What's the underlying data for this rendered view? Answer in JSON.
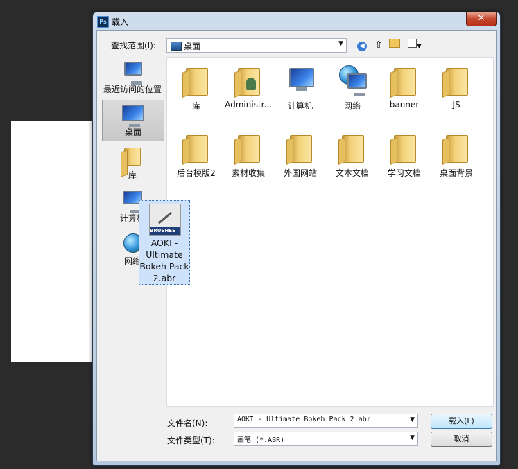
{
  "window": {
    "title": "载入",
    "app_icon": "Ps"
  },
  "toolbar": {
    "lookin_label": "查找范围(I):",
    "lookin_value": "桌面"
  },
  "places": [
    {
      "label": "最近访问的位置",
      "icon": "recent-places-icon"
    },
    {
      "label": "桌面",
      "icon": "desktop-icon"
    },
    {
      "label": "库",
      "icon": "library-icon"
    },
    {
      "label": "计算机",
      "icon": "computer-icon"
    },
    {
      "label": "网络",
      "icon": "network-icon"
    }
  ],
  "files": [
    {
      "label": "库",
      "icon": "library-icon"
    },
    {
      "label": "Administr...",
      "icon": "user-folder-icon"
    },
    {
      "label": "计算机",
      "icon": "computer-icon"
    },
    {
      "label": "网络",
      "icon": "network-icon"
    },
    {
      "label": "banner",
      "icon": "folder-icon"
    },
    {
      "label": "JS",
      "icon": "folder-icon"
    },
    {
      "label": "后台模版2",
      "icon": "folder-icon"
    },
    {
      "label": "素材收集",
      "icon": "folder-icon"
    },
    {
      "label": "外国网站",
      "icon": "folder-icon"
    },
    {
      "label": "文本文档",
      "icon": "folder-icon"
    },
    {
      "label": "学习文档",
      "icon": "folder-icon"
    },
    {
      "label": "桌面背景",
      "icon": "folder-icon"
    }
  ],
  "selected_file": {
    "lines": [
      "AOKI -",
      "Ultimate",
      "Bokeh Pack",
      "2.abr"
    ],
    "badge": "BRUSHES"
  },
  "footer": {
    "filename_label": "文件名(N):",
    "filename_value": "AOKI - Ultimate Bokeh Pack 2.abr",
    "filetype_label": "文件类型(T):",
    "filetype_value": "画笔 (*.ABR)",
    "load_button": "载入(L)",
    "cancel_button": "取消"
  },
  "colors": {
    "selection": "#cfe2fb",
    "title_bar": "#cfdceb",
    "close": "#c2462b"
  }
}
